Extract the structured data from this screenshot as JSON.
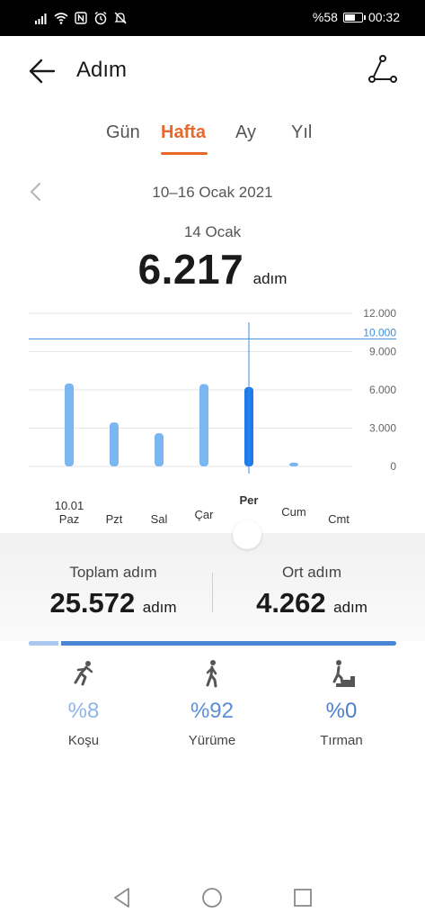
{
  "status_bar": {
    "battery": "%58",
    "battery_level": 0.58,
    "time": "00:32",
    "icons": [
      "signal-icon",
      "wifi-icon",
      "nfc-icon",
      "alarm-icon",
      "mute-icon"
    ]
  },
  "header": {
    "title": "Adım",
    "back_icon": "back-arrow-icon",
    "route_icon": "route-icon"
  },
  "tabs": [
    {
      "label": "Gün",
      "active": false
    },
    {
      "label": "Hafta",
      "active": true
    },
    {
      "label": "Ay",
      "active": false
    },
    {
      "label": "Yıl",
      "active": false
    }
  ],
  "range": {
    "label": "10–16 Ocak 2021",
    "prev_icon": "chevron-left-icon"
  },
  "selection": {
    "date": "14 Ocak",
    "value": "6.217",
    "unit": "adım"
  },
  "chart_data": {
    "type": "bar",
    "categories": [
      "Paz",
      "Pzt",
      "Sal",
      "Çar",
      "Per",
      "Cum",
      "Cmt"
    ],
    "date_label": "10.01",
    "values": [
      6500,
      3450,
      2600,
      6450,
      6217,
      300,
      0
    ],
    "selected_index": 4,
    "ylim": [
      0,
      12000
    ],
    "yticks": [
      0,
      3000,
      6000,
      9000,
      12000
    ],
    "ytick_labels": [
      "0",
      "3.000",
      "6.000",
      "9.000",
      "12.000"
    ],
    "goal": 10000,
    "goal_label": "10.000",
    "colors": {
      "bar": "#7ab6f2",
      "selected": "#1c7be8",
      "goal": "#3a8ee0",
      "grid": "#e6e6e6"
    }
  },
  "summary": {
    "total": {
      "label": "Toplam adım",
      "value": "25.572",
      "unit": "adım"
    },
    "average": {
      "label": "Ort adım",
      "value": "4.262",
      "unit": "adım"
    }
  },
  "split": {
    "run_fraction": 0.08
  },
  "activities": [
    {
      "name": "Koşu",
      "percent": "%8",
      "icon": "running-icon",
      "color": "#8fb4e6"
    },
    {
      "name": "Yürüme",
      "percent": "%92",
      "icon": "walking-icon",
      "color": "#5a8fd8"
    },
    {
      "name": "Tırman",
      "percent": "%0",
      "icon": "climbing-icon",
      "color": "#4a7fce"
    }
  ],
  "nav": {
    "back": "nav-back-icon",
    "home": "nav-home-icon",
    "recents": "nav-recents-icon"
  }
}
